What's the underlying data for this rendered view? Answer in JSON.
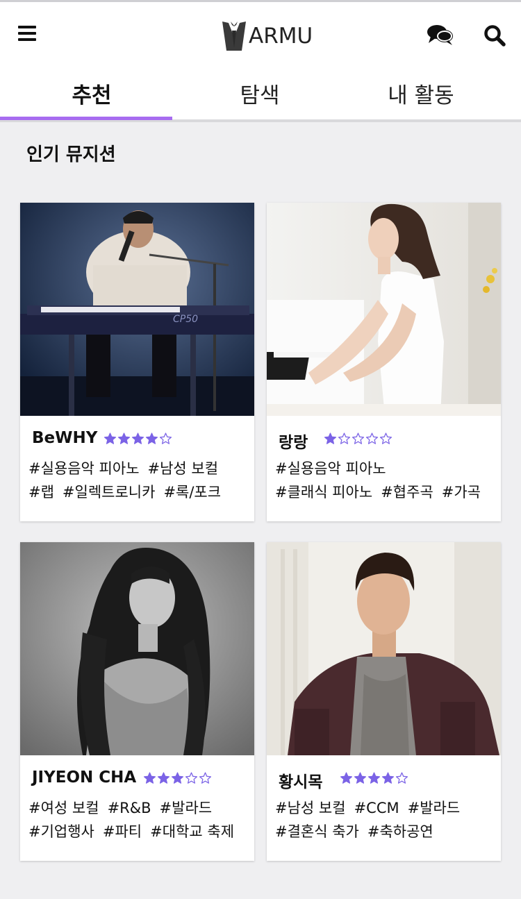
{
  "header": {
    "logo_text": "ARMU",
    "menu_icon": "hamburger-menu-icon",
    "chat_icon": "chat-bubbles-icon",
    "search_icon": "search-icon"
  },
  "tabs": [
    {
      "label": "추천",
      "active": true
    },
    {
      "label": "탐색",
      "active": false
    },
    {
      "label": "내 활동",
      "active": false
    }
  ],
  "section_title": "인기 뮤지션",
  "accent_color": "#a76cf0",
  "star_color": "#7b63e6",
  "musicians": [
    {
      "name": "BeWHY",
      "rating": 4,
      "tags_line1": [
        "#실용음악 피아노",
        "#남성 보컬"
      ],
      "tags_line2": [
        "#랩",
        "#일렉트로니카",
        "#록/포크"
      ]
    },
    {
      "name": "랑랑",
      "rating": 1,
      "tags_line1": [
        "#실용음악 피아노"
      ],
      "tags_line2": [
        "#클래식 피아노",
        "#협주곡",
        "#가곡"
      ]
    },
    {
      "name": "JIYEON CHA",
      "rating": 3,
      "tags_line1": [
        "#여성 보컬",
        "#R&B",
        "#발라드"
      ],
      "tags_line2": [
        "#기업행사",
        "#파티",
        "#대학교 축제"
      ]
    },
    {
      "name": "황시목",
      "rating": 4,
      "tags_line1": [
        "#남성 보컬",
        "#CCM",
        "#발라드"
      ],
      "tags_line2": [
        "#결혼식 축가",
        "#축하공연"
      ]
    }
  ]
}
